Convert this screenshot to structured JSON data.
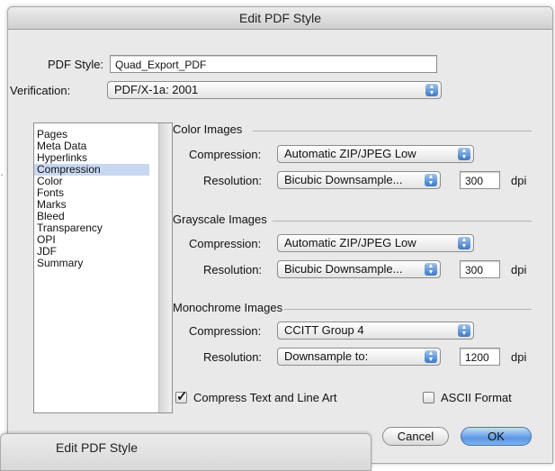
{
  "window": {
    "title": "Edit PDF Style"
  },
  "pdf_style": {
    "label": "PDF Style:",
    "value": "Quad_Export_PDF"
  },
  "verification": {
    "label": "Verification:",
    "value": "PDF/X-1a: 2001"
  },
  "sidebar": {
    "items": [
      "Pages",
      "Meta Data",
      "Hyperlinks",
      "Compression",
      "Color",
      "Fonts",
      "Marks",
      "Bleed",
      "Transparency",
      "OPI",
      "JDF",
      "Summary"
    ],
    "selected": "Compression"
  },
  "color_images": {
    "title": "Color Images",
    "compression_label": "Compression:",
    "compression_value": "Automatic ZIP/JPEG Low",
    "resolution_label": "Resolution:",
    "resolution_value": "Bicubic Downsample...",
    "dpi_value": "300",
    "dpi_unit": "dpi"
  },
  "grayscale_images": {
    "title": "Grayscale Images",
    "compression_label": "Compression:",
    "compression_value": "Automatic ZIP/JPEG Low",
    "resolution_label": "Resolution:",
    "resolution_value": "Bicubic Downsample...",
    "dpi_value": "300",
    "dpi_unit": "dpi"
  },
  "monochrome_images": {
    "title": "Monochrome Images",
    "compression_label": "Compression:",
    "compression_value": "CCITT Group 4",
    "resolution_label": "Resolution:",
    "resolution_value": "Downsample to:",
    "dpi_value": "1200",
    "dpi_unit": "dpi"
  },
  "options": {
    "compress_text_label": "Compress Text and Line Art",
    "compress_text_checked": true,
    "ascii_label": "ASCII Format",
    "ascii_checked": false
  },
  "buttons": {
    "cancel": "Cancel",
    "ok": "OK"
  },
  "background_window": {
    "title": "Edit PDF Style"
  },
  "colors": {
    "selection": "#c9d8f1",
    "default_button": "#5a97e4"
  }
}
